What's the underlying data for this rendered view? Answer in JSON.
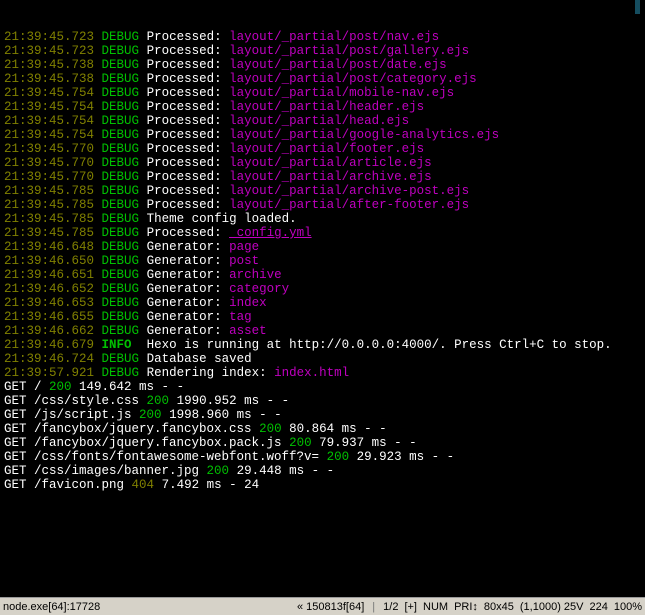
{
  "terminal": {
    "lines": [
      {
        "type": "processed",
        "ts": "21:39:45.723",
        "level": "DEBUG",
        "label": "Processed:",
        "value": "layout/_partial/post/nav.ejs"
      },
      {
        "type": "processed",
        "ts": "21:39:45.723",
        "level": "DEBUG",
        "label": "Processed:",
        "value": "layout/_partial/post/gallery.ejs"
      },
      {
        "type": "processed",
        "ts": "21:39:45.738",
        "level": "DEBUG",
        "label": "Processed:",
        "value": "layout/_partial/post/date.ejs"
      },
      {
        "type": "processed",
        "ts": "21:39:45.738",
        "level": "DEBUG",
        "label": "Processed:",
        "value": "layout/_partial/post/category.ejs"
      },
      {
        "type": "processed",
        "ts": "21:39:45.754",
        "level": "DEBUG",
        "label": "Processed:",
        "value": "layout/_partial/mobile-nav.ejs"
      },
      {
        "type": "processed",
        "ts": "21:39:45.754",
        "level": "DEBUG",
        "label": "Processed:",
        "value": "layout/_partial/header.ejs"
      },
      {
        "type": "processed",
        "ts": "21:39:45.754",
        "level": "DEBUG",
        "label": "Processed:",
        "value": "layout/_partial/head.ejs"
      },
      {
        "type": "processed",
        "ts": "21:39:45.754",
        "level": "DEBUG",
        "label": "Processed:",
        "value": "layout/_partial/google-analytics.ejs"
      },
      {
        "type": "processed",
        "ts": "21:39:45.770",
        "level": "DEBUG",
        "label": "Processed:",
        "value": "layout/_partial/footer.ejs"
      },
      {
        "type": "processed",
        "ts": "21:39:45.770",
        "level": "DEBUG",
        "label": "Processed:",
        "value": "layout/_partial/article.ejs"
      },
      {
        "type": "processed",
        "ts": "21:39:45.770",
        "level": "DEBUG",
        "label": "Processed:",
        "value": "layout/_partial/archive.ejs"
      },
      {
        "type": "processed",
        "ts": "21:39:45.785",
        "level": "DEBUG",
        "label": "Processed:",
        "value": "layout/_partial/archive-post.ejs"
      },
      {
        "type": "processed",
        "ts": "21:39:45.785",
        "level": "DEBUG",
        "label": "Processed:",
        "value": "layout/_partial/after-footer.ejs"
      },
      {
        "type": "plain",
        "ts": "21:39:45.785",
        "level": "DEBUG",
        "text": "Theme config loaded."
      },
      {
        "type": "underline",
        "ts": "21:39:45.785",
        "level": "DEBUG",
        "label": "Processed:",
        "value": "_config.yml"
      },
      {
        "type": "generator",
        "ts": "21:39:46.648",
        "level": "DEBUG",
        "label": "Generator:",
        "value": "page"
      },
      {
        "type": "generator",
        "ts": "21:39:46.650",
        "level": "DEBUG",
        "label": "Generator:",
        "value": "post"
      },
      {
        "type": "generator",
        "ts": "21:39:46.651",
        "level": "DEBUG",
        "label": "Generator:",
        "value": "archive"
      },
      {
        "type": "generator",
        "ts": "21:39:46.652",
        "level": "DEBUG",
        "label": "Generator:",
        "value": "category"
      },
      {
        "type": "generator",
        "ts": "21:39:46.653",
        "level": "DEBUG",
        "label": "Generator:",
        "value": "index"
      },
      {
        "type": "generator",
        "ts": "21:39:46.655",
        "level": "DEBUG",
        "label": "Generator:",
        "value": "tag"
      },
      {
        "type": "generator",
        "ts": "21:39:46.662",
        "level": "DEBUG",
        "label": "Generator:",
        "value": "asset"
      },
      {
        "type": "info",
        "ts": "21:39:46.679",
        "level": "INFO",
        "text": "Hexo is running at http://0.0.0.0:4000/. Press Ctrl+C to stop."
      },
      {
        "type": "plain",
        "ts": "21:39:46.724",
        "level": "DEBUG",
        "text": "Database saved"
      },
      {
        "type": "render",
        "ts": "21:39:57.921",
        "level": "DEBUG",
        "label": "Rendering index:",
        "value": "index.html"
      },
      {
        "type": "get",
        "path": "/",
        "code": "200",
        "tail": "149.642 ms - -"
      },
      {
        "type": "get",
        "path": "/css/style.css",
        "code": "200",
        "tail": "1990.952 ms - -"
      },
      {
        "type": "get",
        "path": "/js/script.js",
        "code": "200",
        "tail": "1998.960 ms - -"
      },
      {
        "type": "get",
        "path": "/fancybox/jquery.fancybox.css",
        "code": "200",
        "tail": "80.864 ms - -"
      },
      {
        "type": "get",
        "path": "/fancybox/jquery.fancybox.pack.js",
        "code": "200",
        "tail": "79.937 ms - -"
      },
      {
        "type": "get",
        "path": "/css/fonts/fontawesome-webfont.woff?v=",
        "code": "200",
        "tail": "29.923 ms - -"
      },
      {
        "type": "get",
        "path": "/css/images/banner.jpg",
        "code": "200",
        "tail": "29.448 ms - -"
      },
      {
        "type": "get",
        "path": "/favicon.png",
        "code": "404",
        "tail": "7.492 ms - 24"
      }
    ]
  },
  "statusbar": {
    "tab": "node.exe[64]:17728",
    "search": "« 150813f[64]",
    "frac": "1/2",
    "plus": "[+]",
    "num": "NUM",
    "pri": "PRI↕",
    "dim": "80x45",
    "pos": "(1,1000) 25V",
    "n1": "224",
    "pct": "100%"
  }
}
